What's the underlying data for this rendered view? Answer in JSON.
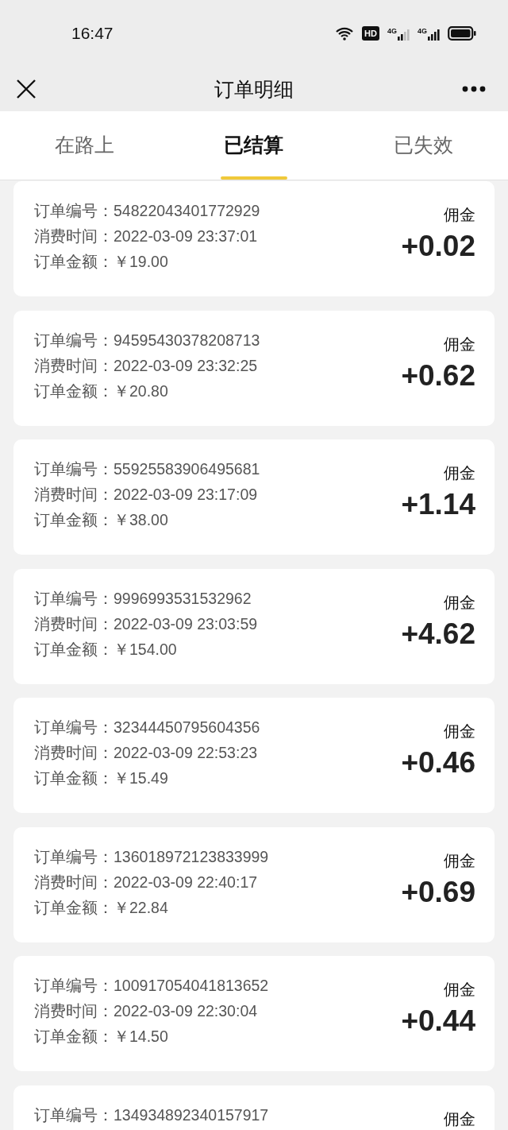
{
  "status_bar": {
    "time": "16:47",
    "hd_label": "HD",
    "network_1": "4G",
    "network_2": "4G"
  },
  "nav": {
    "title": "订单明细"
  },
  "tabs": [
    {
      "label": "在路上",
      "selected": false
    },
    {
      "label": "已结算",
      "selected": true
    },
    {
      "label": "已失效",
      "selected": false
    }
  ],
  "orders": [
    {
      "fields": [
        {
          "label": "订单编号：",
          "value": "54822043401772929"
        },
        {
          "label": "消费时间：",
          "value": "2022-03-09 23:37:01"
        },
        {
          "label": "订单金额：",
          "value": "￥19.00"
        }
      ],
      "commission_label": "佣金",
      "commission": "+0.02"
    },
    {
      "fields": [
        {
          "label": "订单编号：",
          "value": "94595430378208713"
        },
        {
          "label": "消费时间：",
          "value": "2022-03-09 23:32:25"
        },
        {
          "label": "订单金额：",
          "value": "￥20.80"
        }
      ],
      "commission_label": "佣金",
      "commission": "+0.62"
    },
    {
      "fields": [
        {
          "label": "订单编号：",
          "value": "55925583906495681"
        },
        {
          "label": "消费时间：",
          "value": "2022-03-09 23:17:09"
        },
        {
          "label": "订单金额：",
          "value": "￥38.00"
        }
      ],
      "commission_label": "佣金",
      "commission": "+1.14"
    },
    {
      "fields": [
        {
          "label": "订单编号：",
          "value": "9996993531532962"
        },
        {
          "label": "消费时间：",
          "value": "2022-03-09 23:03:59"
        },
        {
          "label": "订单金额：",
          "value": "￥154.00"
        }
      ],
      "commission_label": "佣金",
      "commission": "+4.62"
    },
    {
      "fields": [
        {
          "label": "订单编号：",
          "value": "32344450795604356"
        },
        {
          "label": "消费时间：",
          "value": "2022-03-09 22:53:23"
        },
        {
          "label": "订单金额：",
          "value": "￥15.49"
        }
      ],
      "commission_label": "佣金",
      "commission": "+0.46"
    },
    {
      "fields": [
        {
          "label": "订单编号：",
          "value": "136018972123833999"
        },
        {
          "label": "消费时间：",
          "value": "2022-03-09 22:40:17"
        },
        {
          "label": "订单金额：",
          "value": "￥22.84"
        }
      ],
      "commission_label": "佣金",
      "commission": "+0.69"
    },
    {
      "fields": [
        {
          "label": "订单编号：",
          "value": "100917054041813652"
        },
        {
          "label": "消费时间：",
          "value": "2022-03-09 22:30:04"
        },
        {
          "label": "订单金额：",
          "value": "￥14.50"
        }
      ],
      "commission_label": "佣金",
      "commission": "+0.44"
    },
    {
      "fields": [
        {
          "label": "订单编号：",
          "value": "134934892340157917"
        }
      ],
      "commission_label": "佣金"
    }
  ]
}
